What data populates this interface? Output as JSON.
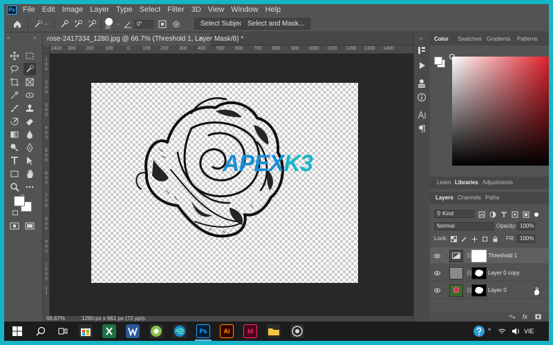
{
  "app": {
    "logo": "Ps",
    "title": "Adobe Photoshop"
  },
  "menu": [
    "File",
    "Edit",
    "Image",
    "Layer",
    "Type",
    "Select",
    "Filter",
    "3D",
    "View",
    "Window",
    "Help"
  ],
  "options": {
    "brush_size": "30",
    "angle": "0°",
    "select_subject": "Select Subject",
    "select_and_mask": "Select and Mask..."
  },
  "document": {
    "tab_title": "rose-2417334_1280.jpg @ 66.7% (Threshold 1, Layer Mask/8) *",
    "close": "×",
    "zoom": "66.67%",
    "dimensions": "1280 px x 961 px (72 ppi)",
    "watermark_a": "APEX",
    "watermark_b": "K3"
  },
  "ruler": {
    "top": [
      "2400",
      "300",
      "200",
      "100",
      "0",
      "100",
      "200",
      "300",
      "400",
      "500",
      "600",
      "700",
      "800",
      "900",
      "1000",
      "1100",
      "1200",
      "1300",
      "1400"
    ],
    "left": [
      "1",
      "0",
      "0",
      "2",
      "0",
      "0",
      "3",
      "0",
      "0",
      "4",
      "0",
      "0",
      "5",
      "0",
      "0",
      "6",
      "0",
      "0",
      "7",
      "0",
      "0",
      "8",
      "0",
      "0",
      "9",
      "0",
      "0",
      "1",
      "0",
      "0",
      "0",
      "1",
      "1"
    ]
  },
  "color_panel": {
    "tabs": [
      "Color",
      "Swatches",
      "Gradients",
      "Patterns"
    ],
    "active": "Color",
    "hue_color": "#e0202a"
  },
  "learn_panel": {
    "tabs": [
      "Learn",
      "Libraries",
      "Adjustments"
    ],
    "active": "Libraries"
  },
  "layers_panel": {
    "tabs": [
      "Layers",
      "Channels",
      "Paths"
    ],
    "active": "Layers",
    "filter": "Kind",
    "blend_mode": "Normal",
    "opacity_label": "Opacity:",
    "opacity": "100%",
    "lock_label": "Lock:",
    "fill_label": "Fill:",
    "fill": "100%",
    "layers": [
      {
        "name": "Threshold 1"
      },
      {
        "name": "Layer 0 copy"
      },
      {
        "name": "Layer 0"
      }
    ],
    "footer_fx": "fx"
  },
  "taskbar": {
    "language": "VIE"
  }
}
